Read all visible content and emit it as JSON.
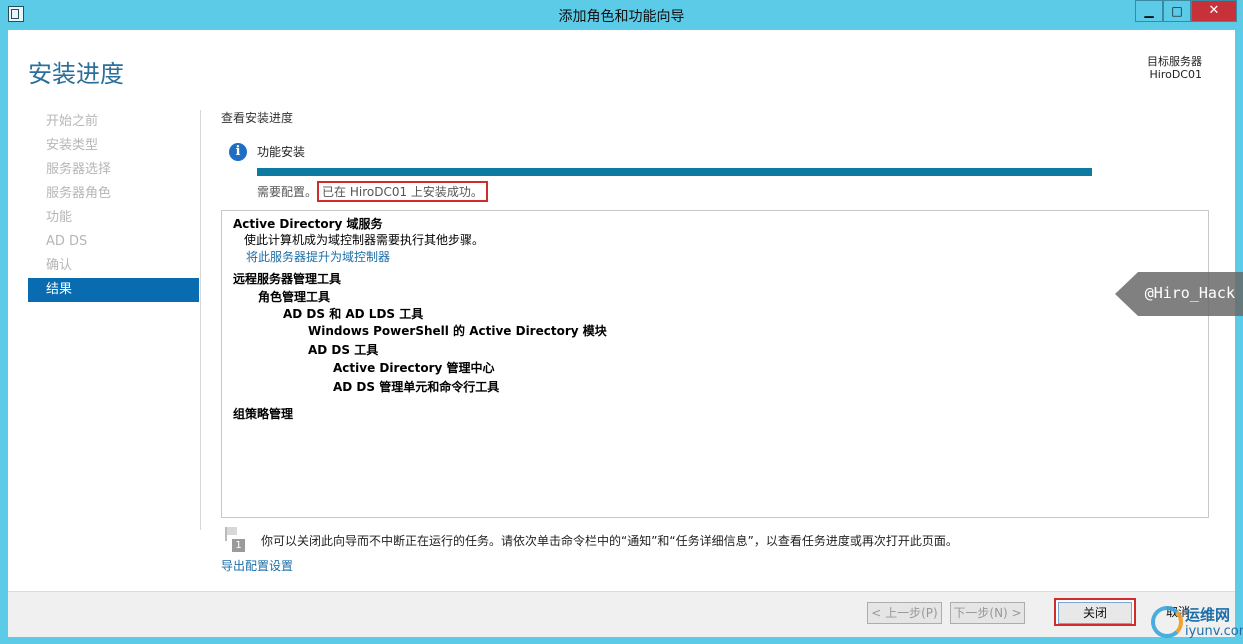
{
  "window": {
    "title": "添加角色和功能向导",
    "minimize": "▁",
    "maximize": "□",
    "close": "✕"
  },
  "page": {
    "title": "安装进度"
  },
  "target_server": {
    "label": "目标服务器",
    "name": "HiroDC01"
  },
  "nav": {
    "items": [
      "开始之前",
      "安装类型",
      "服务器选择",
      "服务器角色",
      "功能",
      "AD DS",
      "确认",
      "结果"
    ],
    "active_index": 7
  },
  "progress": {
    "section_label": "查看安装进度",
    "info_icon": "info-icon",
    "feature_label": "功能安装",
    "percent": 100,
    "status_prefix": "需要配置。",
    "status_highlight": "已在 HiroDC01 上安装成功。"
  },
  "results": {
    "adds_title": "Active Directory 域服务",
    "adds_desc": "使此计算机成为域控制器需要执行其他步骤。",
    "promote_link": "将此服务器提升为域控制器",
    "rsat_title": "远程服务器管理工具",
    "role_tools": "角色管理工具",
    "adds_lds_tools": "AD DS 和 AD LDS 工具",
    "ps_module": "Windows PowerShell 的 Active Directory 模块",
    "adds_tools": "AD DS 工具",
    "ad_admin_center": "Active Directory 管理中心",
    "adds_snapins": "AD DS 管理单元和命令行工具",
    "gpm": "组策略管理"
  },
  "watermark": "@Hiro_Hack",
  "footer": {
    "flag_number": "1",
    "note": "你可以关闭此向导而不中断正在运行的任务。请依次单击命令栏中的“通知”和“任务详细信息”，以查看任务进度或再次打开此页面。",
    "export_link": "导出配置设置"
  },
  "buttons": {
    "prev": "< 上一步(P)",
    "next": "下一步(N) >",
    "close": "关闭",
    "cancel": "取消"
  },
  "logo": {
    "top": "运维网",
    "bottom": "iyunv.com"
  }
}
